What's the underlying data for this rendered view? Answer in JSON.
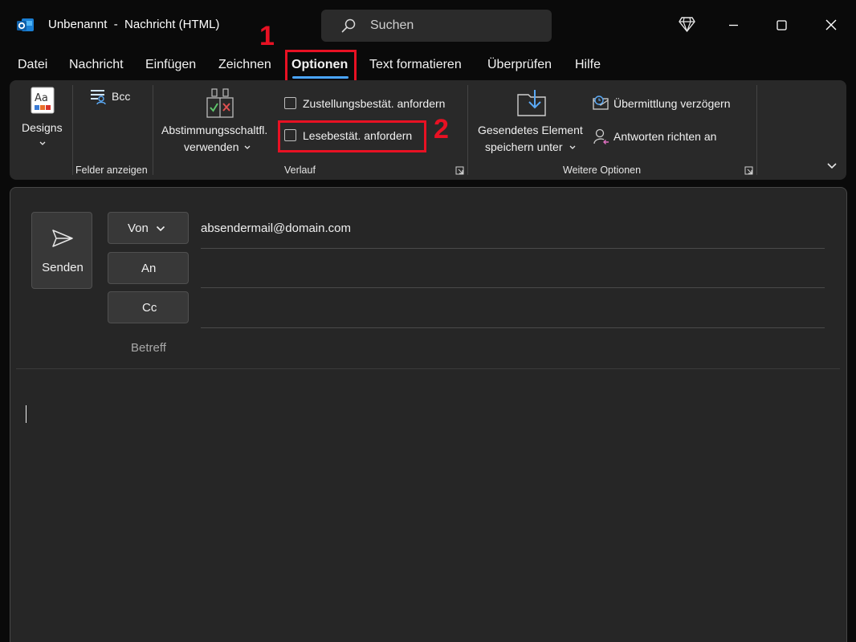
{
  "window": {
    "title": "Unbenannt  -  Nachricht (HTML)",
    "search_placeholder": "Suchen"
  },
  "menu": {
    "tabs": [
      "Datei",
      "Nachricht",
      "Einfügen",
      "Zeichnen",
      "Optionen",
      "Text formatieren",
      "Überprüfen",
      "Hilfe"
    ],
    "active_tab": "Optionen"
  },
  "annotations": {
    "step1": "1",
    "step2": "2",
    "color": "#e81123"
  },
  "ribbon": {
    "designs_label": "Designs",
    "bcc_label": "Bcc",
    "group_show_fields": "Felder anzeigen",
    "voting_label_1": "Abstimmungsschaltfl.",
    "voting_label_2": "verwenden",
    "delivery_receipt_label": "Zustellungsbestät. anfordern",
    "delivery_receipt_checked": false,
    "read_receipt_label": "Lesebestät. anfordern",
    "read_receipt_checked": false,
    "group_tracking": "Verlauf",
    "save_sent_label_1": "Gesendetes Element",
    "save_sent_label_2": "speichern unter",
    "delay_delivery_label": "Übermittlung verzögern",
    "direct_replies_label": "Antworten richten an",
    "group_more_options": "Weitere Optionen"
  },
  "compose": {
    "send_label": "Senden",
    "from_label": "Von",
    "from_value": "absendermail@domain.com",
    "to_label": "An",
    "cc_label": "Cc",
    "subject_label": "Betreff"
  },
  "colors": {
    "accent": "#4aa5ff",
    "annotation": "#e81123",
    "background": "#0a0a0a"
  }
}
